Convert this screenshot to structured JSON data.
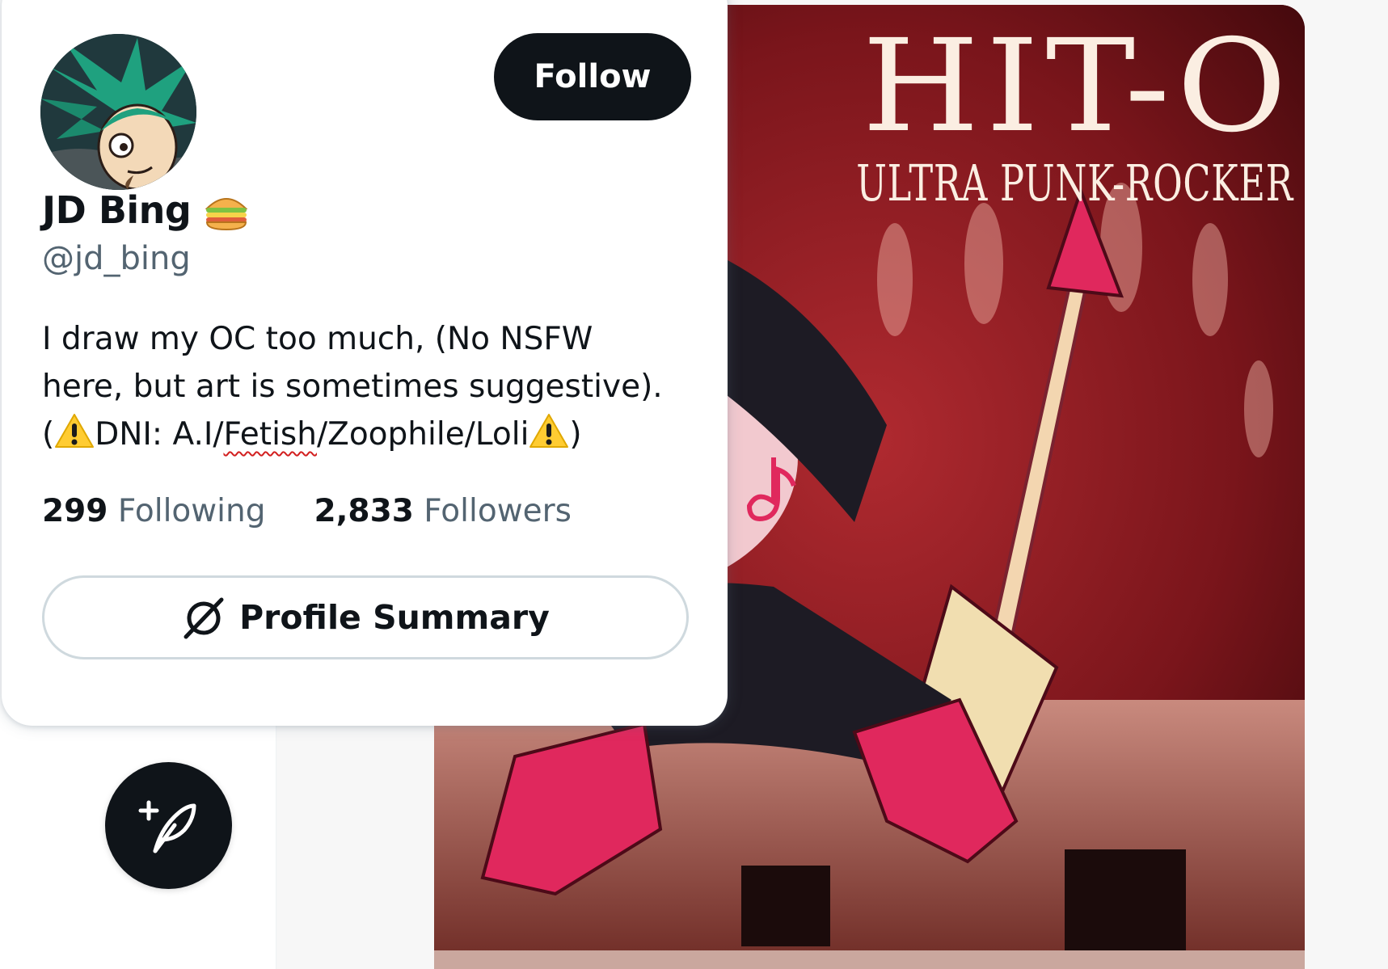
{
  "profile_card": {
    "display_name": "JD Bing",
    "name_emoji": "sandwich-emoji",
    "handle": "@jd_bing",
    "follow_label": "Follow",
    "bio": {
      "line1": "I draw my OC too much, (No NSFW",
      "line2": "here, but art is sometimes suggestive).",
      "line3_open": "(",
      "line3_prefix": "DNI: A.I/",
      "line3_flagged": "Fetish",
      "line3_suffix": "/Zoophile/Loli",
      "line3_close": ")"
    },
    "following_count": "299",
    "following_label": "Following",
    "followers_count": "2,833",
    "followers_label": "Followers",
    "summary_label": "Profile Summary",
    "summary_icon": "grok-icon"
  },
  "media": {
    "title": "HIT-O",
    "subtitle": "ULTRA PUNK-ROCKER"
  },
  "compose": {
    "icon": "compose-post-icon"
  },
  "colors": {
    "text_primary": "#0f1419",
    "text_secondary": "#536471",
    "button_dark": "#0f1419",
    "border": "#cfd9de",
    "spellcheck": "#d21f1f",
    "art_red": "#5c1014",
    "art_pink": "#e8175d"
  }
}
